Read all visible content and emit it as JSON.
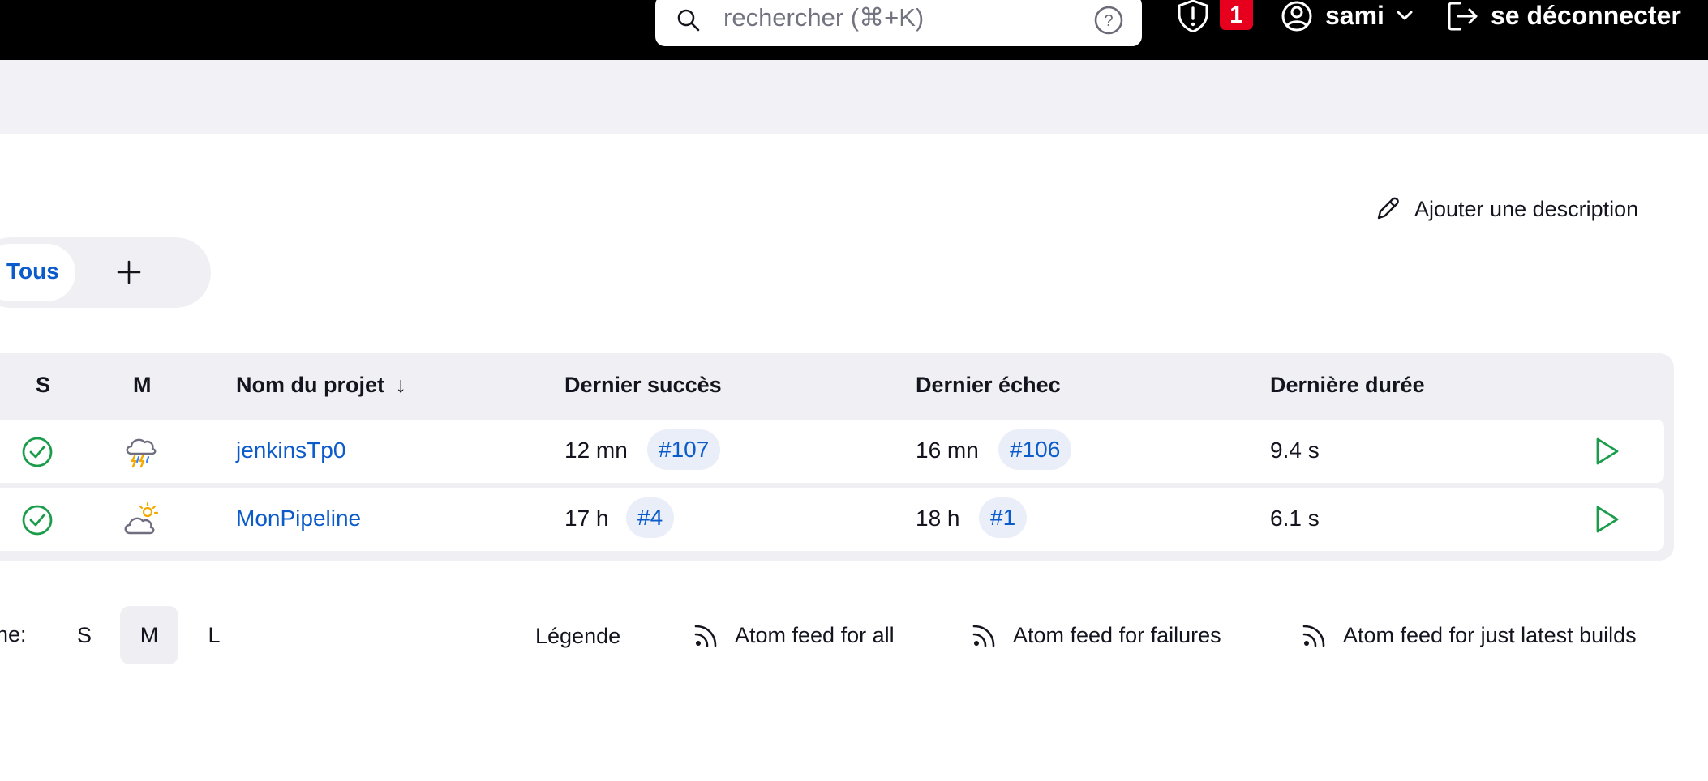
{
  "header": {
    "search_placeholder": "rechercher (⌘+K)",
    "security_count": "1",
    "username": "sami",
    "logout_label": "se déconnecter"
  },
  "main": {
    "add_description": "Ajouter une description",
    "tabs": [
      {
        "label": "Tous",
        "active": true
      }
    ]
  },
  "table": {
    "headers": {
      "status": "S",
      "weather": "M",
      "name": "Nom du projet",
      "sort_indicator": "↓",
      "last_success": "Dernier succès",
      "last_failure": "Dernier échec",
      "last_duration": "Dernière durée"
    },
    "rows": [
      {
        "status_icon": "success-check-icon",
        "weather_icon": "thunderstorm-icon",
        "name": "jenkinsTp0",
        "last_success_time": "12 mn",
        "last_success_build": "#107",
        "last_failure_time": "16 mn",
        "last_failure_build": "#106",
        "duration": "9.4 s"
      },
      {
        "status_icon": "success-check-icon",
        "weather_icon": "partly-cloudy-icon",
        "name": "MonPipeline",
        "last_success_time": "17 h",
        "last_success_build": "#4",
        "last_failure_time": "18 h",
        "last_failure_build": "#1",
        "duration": "6.1 s"
      }
    ]
  },
  "footer": {
    "icon_label": "ône:",
    "sizes": [
      "S",
      "M",
      "L"
    ],
    "selected_size": "M",
    "legend": "Légende",
    "feeds": [
      "Atom feed for all",
      "Atom feed for failures",
      "Atom feed for just latest builds"
    ]
  },
  "colors": {
    "header_bg": "#000000",
    "badge": "#e6001e",
    "link": "#0b5bcb",
    "success": "#1a9c4a",
    "band_bg": "#f2f2f6"
  }
}
